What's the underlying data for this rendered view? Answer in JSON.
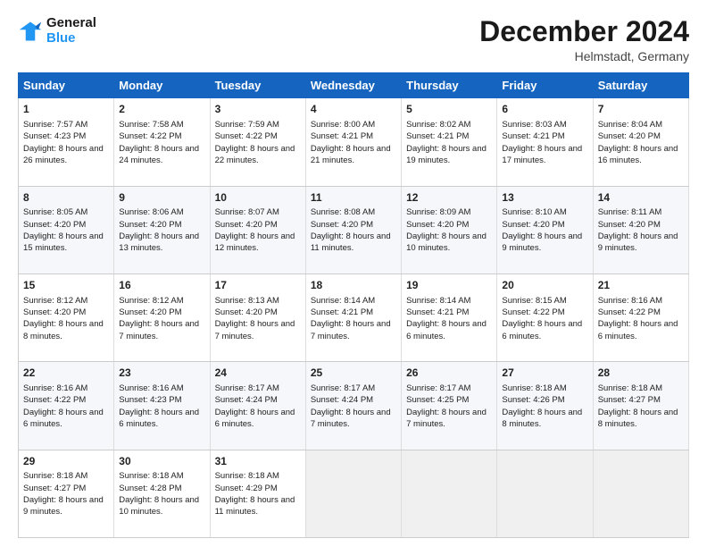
{
  "logo": {
    "line1": "General",
    "line2": "Blue"
  },
  "header": {
    "month": "December 2024",
    "location": "Helmstadt, Germany"
  },
  "weekdays": [
    "Sunday",
    "Monday",
    "Tuesday",
    "Wednesday",
    "Thursday",
    "Friday",
    "Saturday"
  ],
  "weeks": [
    [
      {
        "day": "1",
        "sunrise": "Sunrise: 7:57 AM",
        "sunset": "Sunset: 4:23 PM",
        "daylight": "Daylight: 8 hours and 26 minutes."
      },
      {
        "day": "2",
        "sunrise": "Sunrise: 7:58 AM",
        "sunset": "Sunset: 4:22 PM",
        "daylight": "Daylight: 8 hours and 24 minutes."
      },
      {
        "day": "3",
        "sunrise": "Sunrise: 7:59 AM",
        "sunset": "Sunset: 4:22 PM",
        "daylight": "Daylight: 8 hours and 22 minutes."
      },
      {
        "day": "4",
        "sunrise": "Sunrise: 8:00 AM",
        "sunset": "Sunset: 4:21 PM",
        "daylight": "Daylight: 8 hours and 21 minutes."
      },
      {
        "day": "5",
        "sunrise": "Sunrise: 8:02 AM",
        "sunset": "Sunset: 4:21 PM",
        "daylight": "Daylight: 8 hours and 19 minutes."
      },
      {
        "day": "6",
        "sunrise": "Sunrise: 8:03 AM",
        "sunset": "Sunset: 4:21 PM",
        "daylight": "Daylight: 8 hours and 17 minutes."
      },
      {
        "day": "7",
        "sunrise": "Sunrise: 8:04 AM",
        "sunset": "Sunset: 4:20 PM",
        "daylight": "Daylight: 8 hours and 16 minutes."
      }
    ],
    [
      {
        "day": "8",
        "sunrise": "Sunrise: 8:05 AM",
        "sunset": "Sunset: 4:20 PM",
        "daylight": "Daylight: 8 hours and 15 minutes."
      },
      {
        "day": "9",
        "sunrise": "Sunrise: 8:06 AM",
        "sunset": "Sunset: 4:20 PM",
        "daylight": "Daylight: 8 hours and 13 minutes."
      },
      {
        "day": "10",
        "sunrise": "Sunrise: 8:07 AM",
        "sunset": "Sunset: 4:20 PM",
        "daylight": "Daylight: 8 hours and 12 minutes."
      },
      {
        "day": "11",
        "sunrise": "Sunrise: 8:08 AM",
        "sunset": "Sunset: 4:20 PM",
        "daylight": "Daylight: 8 hours and 11 minutes."
      },
      {
        "day": "12",
        "sunrise": "Sunrise: 8:09 AM",
        "sunset": "Sunset: 4:20 PM",
        "daylight": "Daylight: 8 hours and 10 minutes."
      },
      {
        "day": "13",
        "sunrise": "Sunrise: 8:10 AM",
        "sunset": "Sunset: 4:20 PM",
        "daylight": "Daylight: 8 hours and 9 minutes."
      },
      {
        "day": "14",
        "sunrise": "Sunrise: 8:11 AM",
        "sunset": "Sunset: 4:20 PM",
        "daylight": "Daylight: 8 hours and 9 minutes."
      }
    ],
    [
      {
        "day": "15",
        "sunrise": "Sunrise: 8:12 AM",
        "sunset": "Sunset: 4:20 PM",
        "daylight": "Daylight: 8 hours and 8 minutes."
      },
      {
        "day": "16",
        "sunrise": "Sunrise: 8:12 AM",
        "sunset": "Sunset: 4:20 PM",
        "daylight": "Daylight: 8 hours and 7 minutes."
      },
      {
        "day": "17",
        "sunrise": "Sunrise: 8:13 AM",
        "sunset": "Sunset: 4:20 PM",
        "daylight": "Daylight: 8 hours and 7 minutes."
      },
      {
        "day": "18",
        "sunrise": "Sunrise: 8:14 AM",
        "sunset": "Sunset: 4:21 PM",
        "daylight": "Daylight: 8 hours and 7 minutes."
      },
      {
        "day": "19",
        "sunrise": "Sunrise: 8:14 AM",
        "sunset": "Sunset: 4:21 PM",
        "daylight": "Daylight: 8 hours and 6 minutes."
      },
      {
        "day": "20",
        "sunrise": "Sunrise: 8:15 AM",
        "sunset": "Sunset: 4:22 PM",
        "daylight": "Daylight: 8 hours and 6 minutes."
      },
      {
        "day": "21",
        "sunrise": "Sunrise: 8:16 AM",
        "sunset": "Sunset: 4:22 PM",
        "daylight": "Daylight: 8 hours and 6 minutes."
      }
    ],
    [
      {
        "day": "22",
        "sunrise": "Sunrise: 8:16 AM",
        "sunset": "Sunset: 4:22 PM",
        "daylight": "Daylight: 8 hours and 6 minutes."
      },
      {
        "day": "23",
        "sunrise": "Sunrise: 8:16 AM",
        "sunset": "Sunset: 4:23 PM",
        "daylight": "Daylight: 8 hours and 6 minutes."
      },
      {
        "day": "24",
        "sunrise": "Sunrise: 8:17 AM",
        "sunset": "Sunset: 4:24 PM",
        "daylight": "Daylight: 8 hours and 6 minutes."
      },
      {
        "day": "25",
        "sunrise": "Sunrise: 8:17 AM",
        "sunset": "Sunset: 4:24 PM",
        "daylight": "Daylight: 8 hours and 7 minutes."
      },
      {
        "day": "26",
        "sunrise": "Sunrise: 8:17 AM",
        "sunset": "Sunset: 4:25 PM",
        "daylight": "Daylight: 8 hours and 7 minutes."
      },
      {
        "day": "27",
        "sunrise": "Sunrise: 8:18 AM",
        "sunset": "Sunset: 4:26 PM",
        "daylight": "Daylight: 8 hours and 8 minutes."
      },
      {
        "day": "28",
        "sunrise": "Sunrise: 8:18 AM",
        "sunset": "Sunset: 4:27 PM",
        "daylight": "Daylight: 8 hours and 8 minutes."
      }
    ],
    [
      {
        "day": "29",
        "sunrise": "Sunrise: 8:18 AM",
        "sunset": "Sunset: 4:27 PM",
        "daylight": "Daylight: 8 hours and 9 minutes."
      },
      {
        "day": "30",
        "sunrise": "Sunrise: 8:18 AM",
        "sunset": "Sunset: 4:28 PM",
        "daylight": "Daylight: 8 hours and 10 minutes."
      },
      {
        "day": "31",
        "sunrise": "Sunrise: 8:18 AM",
        "sunset": "Sunset: 4:29 PM",
        "daylight": "Daylight: 8 hours and 11 minutes."
      },
      null,
      null,
      null,
      null
    ]
  ]
}
